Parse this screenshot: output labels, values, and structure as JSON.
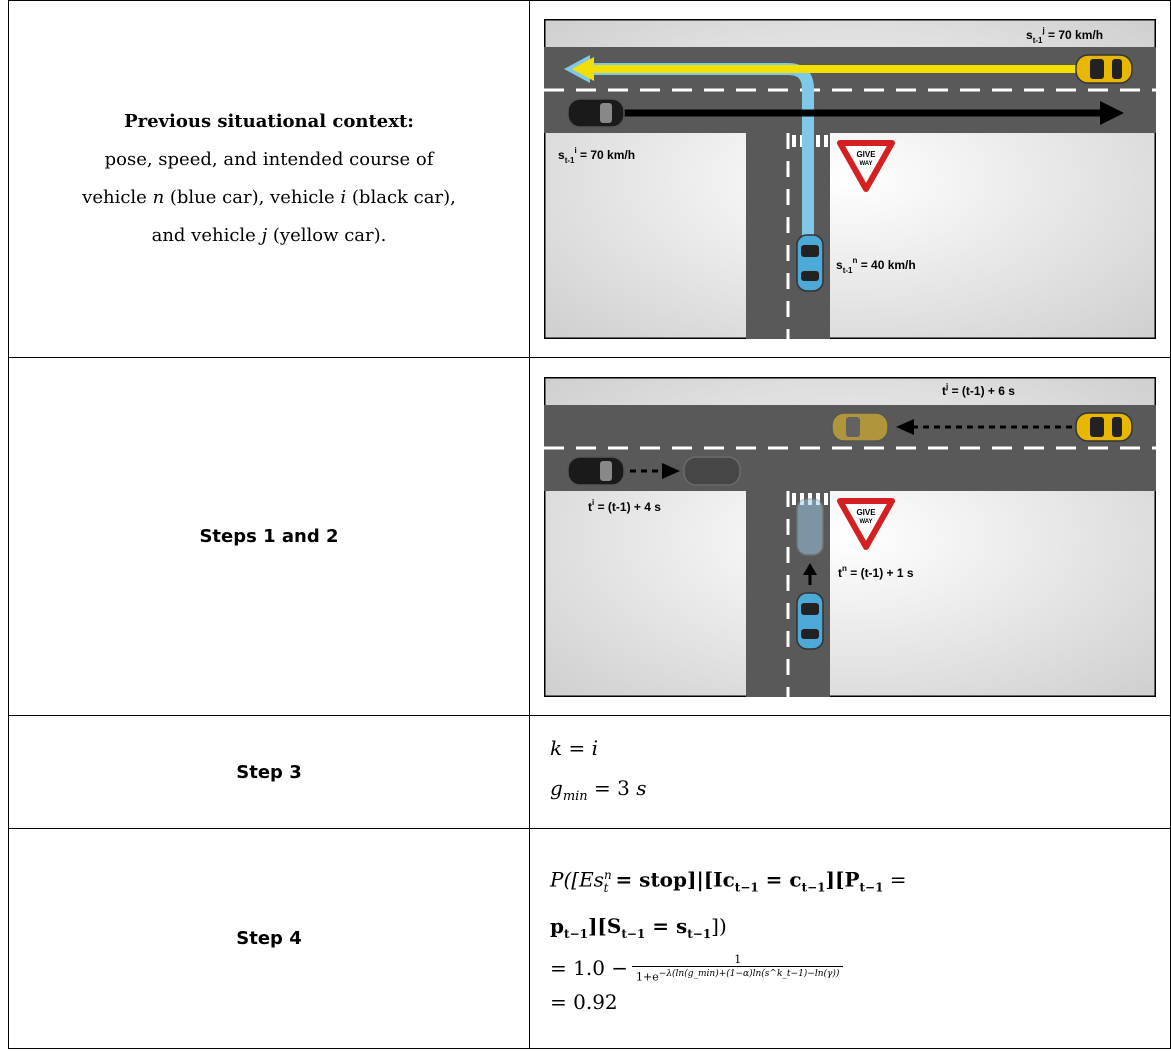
{
  "rows": [
    {
      "label": {
        "title": "Previous situational context:",
        "line1": "pose, speed, and intended course of",
        "line2_a": "vehicle ",
        "line2_n": "n",
        "line2_b": " (blue car), vehicle ",
        "line2_i": "i",
        "line2_c": " (black car),",
        "line3_a": "and vehicle ",
        "line3_j": "j",
        "line3_b": " (yellow car)."
      },
      "figure": {
        "speed_yellow": "s",
        "speed_yellow_sub": "t-1",
        "speed_yellow_sup": "j",
        "speed_yellow_val": " = 70 km/h",
        "speed_black": "s",
        "speed_black_sub": "t-1",
        "speed_black_sup": "i",
        "speed_black_val": " = 70 km/h",
        "speed_blue": "s",
        "speed_blue_sub": "t-1",
        "speed_blue_sup": "n",
        "speed_blue_val": " = 40 km/h",
        "sign_line1": "GIVE",
        "sign_line2": "WAY"
      }
    },
    {
      "label": {
        "title": "Steps 1 and 2"
      },
      "figure": {
        "time_yellow": "t",
        "time_yellow_sup": "j",
        "time_yellow_val": " = (t-1) + 6 s",
        "time_black": "t",
        "time_black_sup": "i",
        "time_black_val": " = (t-1) + 4 s",
        "time_blue": "t",
        "time_blue_sup": "n",
        "time_blue_val": " = (t-1) + 1 s",
        "sign_line1": "GIVE",
        "sign_line2": "WAY"
      }
    },
    {
      "label": {
        "title": "Step 3"
      },
      "math": {
        "k": "k",
        "eq": " = ",
        "i": "i",
        "g": "g",
        "g_sub": "min",
        "g_val": " = 3 ",
        "s": "s"
      }
    },
    {
      "label": {
        "title": "Step 4"
      },
      "math": {
        "line1": "P([Es",
        "line1_sup": "n",
        "line1_sub": "t",
        "line1_b": " = stop]|[Ic",
        "line1_c": "t−1",
        "line1_d": " = c",
        "line1_e": "t−1",
        "line1_f": "][P",
        "line1_g": "t−1",
        "line1_h": " =",
        "line2": "p",
        "line2_sub": "t−1",
        "line2_b": "][S",
        "line2_c": "t−1",
        "line2_d": " = s",
        "line2_e": "t−1",
        "line2_f": "])",
        "line3_a": "= 1.0 − ",
        "frac_num": "1",
        "frac_den": "1+e",
        "frac_exp": "−λ(ln(g_min)+(1−α)ln(s^k_t−1)−ln(γ))",
        "line4": "= 0.92"
      }
    }
  ]
}
